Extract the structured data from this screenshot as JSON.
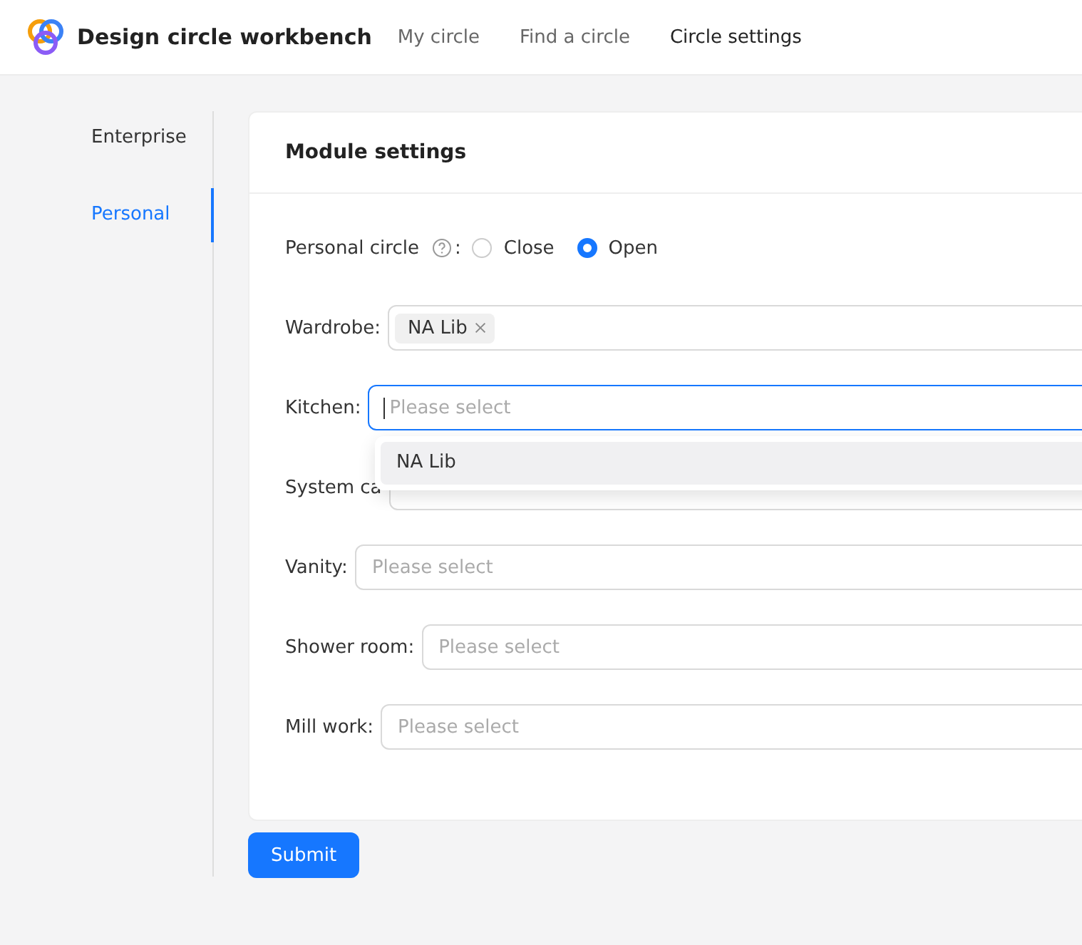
{
  "header": {
    "title": "Design circle workbench",
    "nav": [
      {
        "label": "My circle",
        "selected": false
      },
      {
        "label": "Find a circle",
        "selected": false
      },
      {
        "label": "Circle settings",
        "selected": true
      }
    ]
  },
  "sidebar": {
    "items": [
      {
        "label": "Enterprise",
        "selected": false
      },
      {
        "label": "Personal",
        "selected": true
      }
    ]
  },
  "card": {
    "title": "Module settings",
    "personal_circle": {
      "label": "Personal circle",
      "separator": ":",
      "options": [
        {
          "label": "Close",
          "selected": false
        },
        {
          "label": "Open",
          "selected": true
        }
      ]
    },
    "fields": [
      {
        "label": "Wardrobe",
        "separator": ":",
        "tags": [
          "NA Lib"
        ],
        "focused": false
      },
      {
        "label": "Kitchen",
        "separator": ":",
        "placeholder": "Please select",
        "focused": true,
        "dropdown": [
          {
            "label": "NA Lib",
            "selected": true
          }
        ]
      },
      {
        "label": "System ca",
        "focused": false
      },
      {
        "label": "Vanity",
        "separator": ":",
        "placeholder": "Please select",
        "focused": false
      },
      {
        "label": "Shower room",
        "separator": ":",
        "placeholder": "Please select",
        "focused": false
      },
      {
        "label": "Mill work",
        "separator": ":",
        "placeholder": "Please select",
        "focused": false
      }
    ]
  },
  "submit": "Submit"
}
